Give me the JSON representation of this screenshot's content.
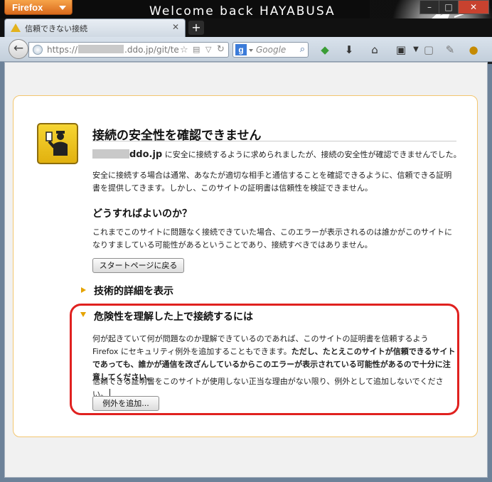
{
  "browser": {
    "app_button": "Firefox",
    "banner": "Welcome back HAYABUSA",
    "tab_title": "信頼できない接続",
    "new_tab": "+",
    "url_prefix": "https://",
    "url_suffix": ".ddo.jp/git/tes",
    "search_placeholder": "Google"
  },
  "page": {
    "title": "接続の安全性を確認できません",
    "host": "ddo.jp",
    "intro": "に安全に接続するように求められましたが、接続の安全性が確認できませんでした。",
    "para1": "安全に接続する場合は通常、あなたが適切な相手と通信することを確認できるように、信頼できる証明書を提供してきます。しかし、このサイトの証明書は信頼性を検証できません。",
    "whatshould_title": "どうすればよいのか？",
    "whatshould_text": "これまでこのサイトに問題なく接続できていた場合、このエラーが表示されるのは誰かがこのサイトになりすましている可能性があるということであり、接続すべきではありません。",
    "getme_out_button": "スタートページに戻る",
    "technical_title": "技術的詳細を表示",
    "risk_title": "危険性を理解した上で接続するには",
    "risk_text_normal": "何が起きていて何が問題なのか理解できているのであれば、このサイトの証明書を信頼するよう Firefox にセキュリティ例外を追加することもできます。",
    "risk_text_bold": "ただし、たとえこのサイトが信頼できるサイトであっても、誰かが通信を改ざんしているからこのエラーが表示されている可能性があるので十分に注意してください。",
    "risk_text2": "信頼できる証明書をこのサイトが使用しない正当な理由がない限り、例外として追加しないでください。",
    "add_exception_button": "例外を追加..."
  },
  "colors": {
    "highlight_border": "#e0211f",
    "box_border": "#f3c66f",
    "expander": "#e5a300"
  }
}
